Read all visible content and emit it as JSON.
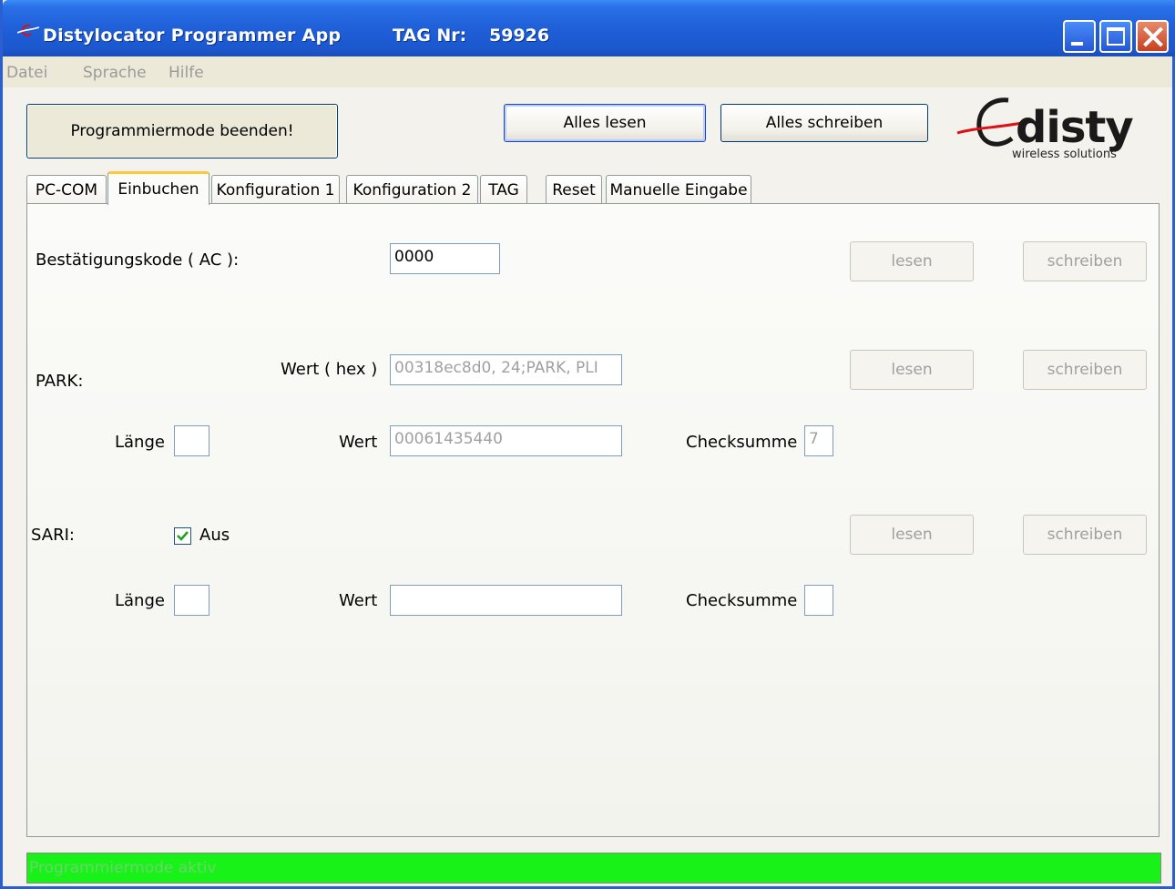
{
  "window": {
    "title": "Distylocator Programmer App",
    "tag_label": "TAG Nr:",
    "tag_number": "59926",
    "title_color": "#1f5fd8"
  },
  "menu": {
    "items": [
      "Datei",
      "Sprache",
      "Hilfe"
    ]
  },
  "toolbar": {
    "end_program_mode": "Programmiermode beenden!",
    "read_all": "Alles lesen",
    "write_all": "Alles schreiben"
  },
  "logo": {
    "name": "disty",
    "tagline": "wireless solutions"
  },
  "tabs": [
    {
      "label": "PC-COM",
      "active": false
    },
    {
      "label": "Einbuchen",
      "active": true
    },
    {
      "label": "Konfiguration 1",
      "active": false
    },
    {
      "label": "Konfiguration 2",
      "active": false
    },
    {
      "label": "TAG",
      "active": false
    },
    {
      "label": "Reset",
      "active": false
    },
    {
      "label": "Manuelle Eingabe",
      "active": false
    }
  ],
  "einbuchen": {
    "ac": {
      "label": "Bestätigungskode ( AC ):",
      "value": "0000",
      "read": "lesen",
      "write": "schreiben"
    },
    "park": {
      "label": "PARK:",
      "hex_label": "Wert ( hex )",
      "hex_value": "00318ec8d0, 24;PARK, PLI",
      "length_label": "Länge",
      "length_value": "",
      "value_label": "Wert",
      "value": "00061435440",
      "checksum_label": "Checksumme",
      "checksum_value": "7",
      "read": "lesen",
      "write": "schreiben"
    },
    "sari": {
      "label": "SARI:",
      "off_label": "Aus",
      "off_checked": true,
      "length_label": "Länge",
      "length_value": "",
      "value_label": "Wert",
      "value": "",
      "checksum_label": "Checksumme",
      "checksum_value": "",
      "read": "lesen",
      "write": "schreiben"
    }
  },
  "status": {
    "text": "Programmiermode aktiv",
    "color": "#19f219"
  }
}
